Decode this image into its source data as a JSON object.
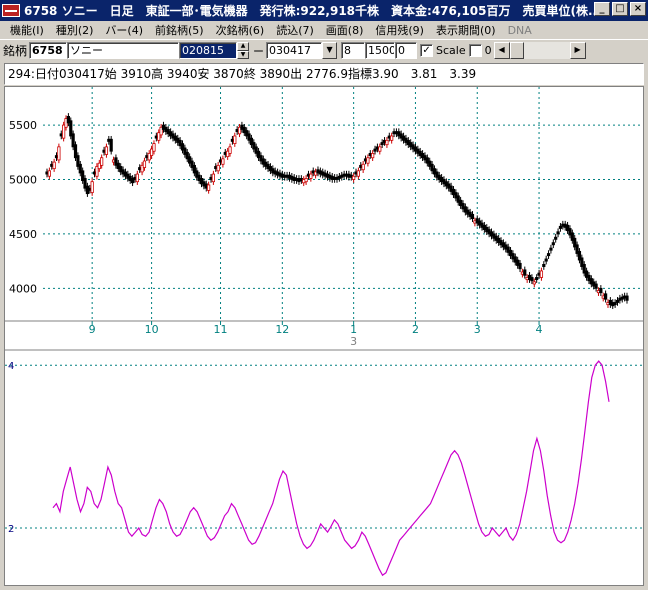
{
  "window": {
    "title": "6758 ソニー　日足　東証一部･電気機器　発行株:922,918千株　資本金:476,105百万　売買単位(株...",
    "buttons": {
      "minimize": "_",
      "maximize": "□",
      "close": "×"
    }
  },
  "menu": {
    "items": [
      {
        "label": "機能(I)",
        "enabled": true
      },
      {
        "label": "種別(2)",
        "enabled": true
      },
      {
        "label": "バー(4)",
        "enabled": true
      },
      {
        "label": "前銘柄(5)",
        "enabled": true
      },
      {
        "label": "次銘柄(6)",
        "enabled": true
      },
      {
        "label": "読込(7)",
        "enabled": true
      },
      {
        "label": "画面(8)",
        "enabled": true
      },
      {
        "label": "信用残(9)",
        "enabled": true
      },
      {
        "label": "表示期間(0)",
        "enabled": true
      },
      {
        "label": "DNA",
        "enabled": false
      }
    ]
  },
  "toolbar": {
    "code_label": "銘柄",
    "code_value": "6758",
    "name_value": "ソニー",
    "from_date": "020815",
    "separator": "ー",
    "to_date": "030417",
    "field_a": "8",
    "field_b": "1500",
    "field_c": "0",
    "scale_checked": true,
    "scale_label": "Scale",
    "scale_value": "0"
  },
  "info": {
    "text": "294:日付030417始 3910高 3940安 3870終 3890出 2776.9指標3.90　3.81　3.39"
  },
  "colors": {
    "up_candle": "#cc0000",
    "down_candle": "#000000",
    "indicator": "#cc00cc",
    "grid": "#008080",
    "axis_text": "#000080"
  },
  "chart_data": [
    {
      "type": "candlestick",
      "price_ticks": [
        "5500",
        "5000",
        "4500",
        "4000"
      ],
      "price_tick_values": [
        5500,
        5000,
        4500,
        4000
      ],
      "ylim": [
        3700,
        5850
      ],
      "month_labels": [
        "9",
        "10",
        "11",
        "12",
        "1",
        "2",
        "3",
        "4"
      ],
      "month_label_x_index": [
        19,
        44,
        73,
        99,
        129,
        155,
        181,
        207
      ],
      "year_marker": "3",
      "close_series": [
        5050,
        5080,
        5120,
        5160,
        5200,
        5300,
        5400,
        5500,
        5560,
        5520,
        5400,
        5300,
        5200,
        5120,
        5060,
        4990,
        4920,
        4870,
        4900,
        4980,
        5050,
        5120,
        5150,
        5200,
        5250,
        5300,
        5350,
        5260,
        5180,
        5130,
        5100,
        5070,
        5050,
        5030,
        5010,
        4990,
        4970,
        5000,
        5050,
        5090,
        5130,
        5170,
        5200,
        5240,
        5280,
        5330,
        5380,
        5430,
        5480,
        5460,
        5440,
        5420,
        5400,
        5380,
        5360,
        5340,
        5310,
        5270,
        5230,
        5190,
        5150,
        5110,
        5060,
        5020,
        4990,
        4960,
        4940,
        4920,
        4950,
        5000,
        5050,
        5100,
        5130,
        5160,
        5190,
        5230,
        5260,
        5300,
        5350,
        5400,
        5440,
        5480,
        5460,
        5430,
        5400,
        5360,
        5320,
        5280,
        5240,
        5200,
        5170,
        5140,
        5120,
        5100,
        5080,
        5060,
        5050,
        5040,
        5030,
        5020,
        5020,
        5020,
        5010,
        5000,
        4990,
        4990,
        4980,
        4990,
        5000,
        5010,
        5030,
        5050,
        5060,
        5070,
        5060,
        5050,
        5040,
        5030,
        5020,
        5010,
        5000,
        5000,
        5000,
        5010,
        5020,
        5030,
        5030,
        5020,
        5020,
        5030,
        5050,
        5080,
        5110,
        5140,
        5170,
        5200,
        5220,
        5240,
        5260,
        5280,
        5300,
        5320,
        5340,
        5360,
        5380,
        5400,
        5420,
        5420,
        5400,
        5380,
        5360,
        5340,
        5320,
        5300,
        5280,
        5260,
        5240,
        5220,
        5200,
        5180,
        5150,
        5120,
        5080,
        5050,
        5020,
        5000,
        4980,
        4960,
        4940,
        4920,
        4890,
        4860,
        4830,
        4790,
        4760,
        4730,
        4700,
        4680,
        4660,
        4640,
        4620,
        4600,
        4580,
        4560,
        4540,
        4520,
        4500,
        4480,
        4460,
        4440,
        4420,
        4400,
        4380,
        4360,
        4330,
        4300,
        4270,
        4240,
        4210,
        4180,
        4150,
        4120,
        4100,
        4080,
        4070,
        4060,
        4080,
        4120,
        4160,
        4200,
        4250,
        4300,
        4350,
        4400,
        4450,
        4500,
        4550,
        4570,
        4560,
        4530,
        4490,
        4440,
        4380,
        4320,
        4260,
        4200,
        4140,
        4100,
        4070,
        4040,
        4020,
        4000,
        3980,
        3960,
        3930,
        3900,
        3870,
        3850,
        3840,
        3850,
        3870,
        3890,
        3900,
        3910,
        3890
      ],
      "up_days": [
        1,
        3,
        5,
        7,
        8,
        19,
        21,
        22,
        23,
        25,
        28,
        38,
        40,
        41,
        43,
        44,
        45,
        47,
        48,
        68,
        70,
        72,
        74,
        76,
        77,
        79,
        81,
        108,
        109,
        111,
        113,
        129,
        131,
        133,
        135,
        137,
        140,
        143,
        145,
        180,
        200,
        202,
        205,
        208,
        232,
        234,
        236
      ]
    },
    {
      "type": "line",
      "yticks": [
        "4",
        "2"
      ],
      "ytick_values": [
        4,
        2
      ],
      "ylim": [
        1.3,
        4.15
      ],
      "values": [
        2.25,
        2.3,
        2.2,
        2.45,
        2.6,
        2.75,
        2.55,
        2.35,
        2.2,
        2.3,
        2.5,
        2.45,
        2.3,
        2.25,
        2.35,
        2.55,
        2.75,
        2.65,
        2.45,
        2.3,
        2.25,
        2.1,
        1.95,
        1.9,
        1.95,
        2.0,
        1.92,
        1.9,
        1.95,
        2.1,
        2.25,
        2.35,
        2.3,
        2.2,
        2.05,
        1.95,
        1.9,
        1.92,
        2.0,
        2.1,
        2.2,
        2.25,
        2.2,
        2.1,
        2.0,
        1.9,
        1.85,
        1.88,
        1.95,
        2.05,
        2.15,
        2.2,
        2.3,
        2.25,
        2.15,
        2.05,
        1.95,
        1.85,
        1.8,
        1.82,
        1.9,
        2.0,
        2.1,
        2.2,
        2.3,
        2.45,
        2.6,
        2.7,
        2.65,
        2.45,
        2.25,
        2.05,
        1.9,
        1.8,
        1.75,
        1.78,
        1.85,
        1.95,
        2.05,
        2.0,
        1.95,
        2.02,
        2.1,
        2.05,
        1.95,
        1.85,
        1.8,
        1.75,
        1.78,
        1.85,
        1.95,
        1.9,
        1.8,
        1.7,
        1.6,
        1.5,
        1.42,
        1.45,
        1.55,
        1.65,
        1.75,
        1.85,
        1.9,
        1.95,
        2.0,
        2.05,
        2.1,
        2.15,
        2.2,
        2.25,
        2.3,
        2.4,
        2.5,
        2.6,
        2.7,
        2.8,
        2.9,
        2.95,
        2.9,
        2.8,
        2.65,
        2.5,
        2.35,
        2.2,
        2.05,
        1.95,
        1.9,
        1.92,
        2.0,
        1.95,
        1.9,
        1.95,
        2.0,
        1.9,
        1.85,
        1.92,
        2.05,
        2.25,
        2.45,
        2.7,
        2.95,
        3.1,
        2.95,
        2.7,
        2.4,
        2.15,
        1.95,
        1.85,
        1.82,
        1.85,
        1.95,
        2.1,
        2.3,
        2.55,
        2.85,
        3.2,
        3.55,
        3.85,
        4.0,
        4.05,
        4.0,
        3.8,
        3.55
      ]
    }
  ]
}
